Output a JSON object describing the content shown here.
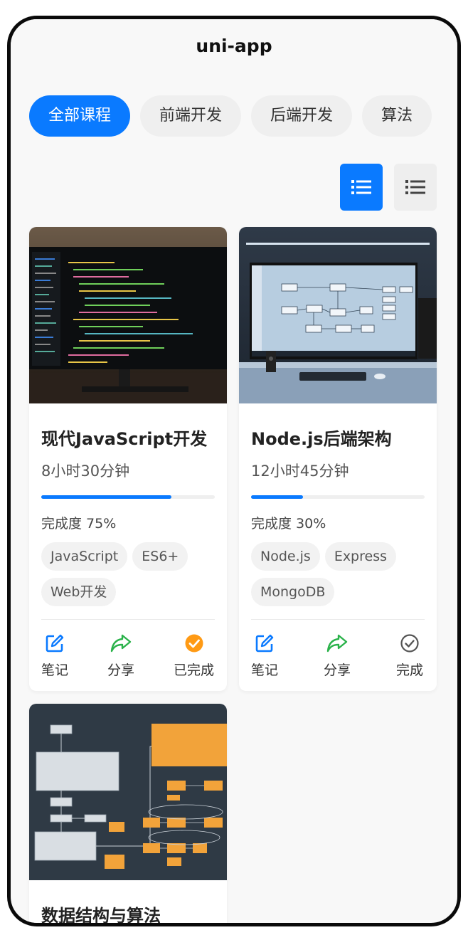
{
  "nav": {
    "title": "uni-app"
  },
  "tabs": [
    {
      "label": "全部课程",
      "active": true
    },
    {
      "label": "前端开发",
      "active": false
    },
    {
      "label": "后端开发",
      "active": false
    },
    {
      "label": "算法",
      "active": false
    }
  ],
  "view_toggle": {
    "list_icon": "list-icon",
    "compact_icon": "list-icon"
  },
  "colors": {
    "accent": "#0a7aff",
    "share": "#2ab24a",
    "done": "#ff9a14"
  },
  "courses": [
    {
      "thumbnail": "monitor-with-code-image",
      "title": "现代JavaScript开发",
      "duration": "8小时30分钟",
      "progress": 0.75,
      "progress_text": "完成度 75%",
      "tags": [
        "JavaScript",
        "ES6+",
        "Web开发"
      ],
      "actions": {
        "note": "笔记",
        "share": "分享",
        "status": "已完成"
      },
      "completed": true
    },
    {
      "thumbnail": "monitor-with-flowchart-image",
      "title": "Node.js后端架构",
      "duration": "12小时45分钟",
      "progress": 0.3,
      "progress_text": "完成度 30%",
      "tags": [
        "Node.js",
        "Express",
        "MongoDB"
      ],
      "actions": {
        "note": "笔记",
        "share": "分享",
        "status": "完成"
      },
      "completed": false
    },
    {
      "thumbnail": "algorithm-flowchart-image",
      "title": "数据结构与算法"
    }
  ]
}
